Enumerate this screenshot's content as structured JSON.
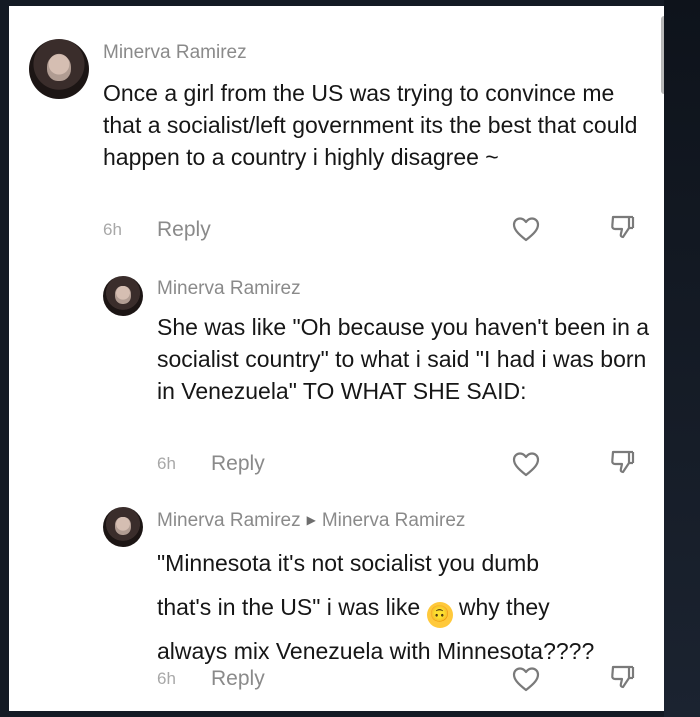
{
  "comments": [
    {
      "author": "Minerva Ramirez",
      "text": "Once a girl from the US was trying to convince me that a socialist/left government its the best that could happen to a country i highly disagree ~",
      "time": "6h",
      "reply_label": "Reply",
      "icons": [
        "avatar",
        "heart-icon",
        "dislike-icon"
      ]
    },
    {
      "author": "Minerva Ramirez",
      "text": "She was like \"Oh because you haven't been in a socialist country\" to what i said \"I had i was born in Venezuela\" TO WHAT SHE SAID:",
      "time": "6h",
      "reply_label": "Reply",
      "icons": [
        "avatar",
        "heart-icon",
        "dislike-icon"
      ]
    },
    {
      "author": "Minerva Ramirez",
      "reply_to": "Minerva Ramirez",
      "text_line1": "\"Minnesota it's not socialist you dumb",
      "text_line2_before": "that's in the US\" i was like",
      "emoji": "🙃",
      "text_line2_after": "why they",
      "text_line3": "always mix Venezuela with Minnesota????",
      "time": "6h",
      "reply_label": "Reply",
      "icons": [
        "avatar",
        "heart-icon",
        "dislike-icon",
        "caret-right-icon",
        "upside-down-face-emoji"
      ]
    }
  ],
  "colors": {
    "author": "#8a8a8a",
    "text": "#161616",
    "time": "#a8a8a8",
    "icon_stroke": "#7a7a7a",
    "background": "#ffffff"
  }
}
